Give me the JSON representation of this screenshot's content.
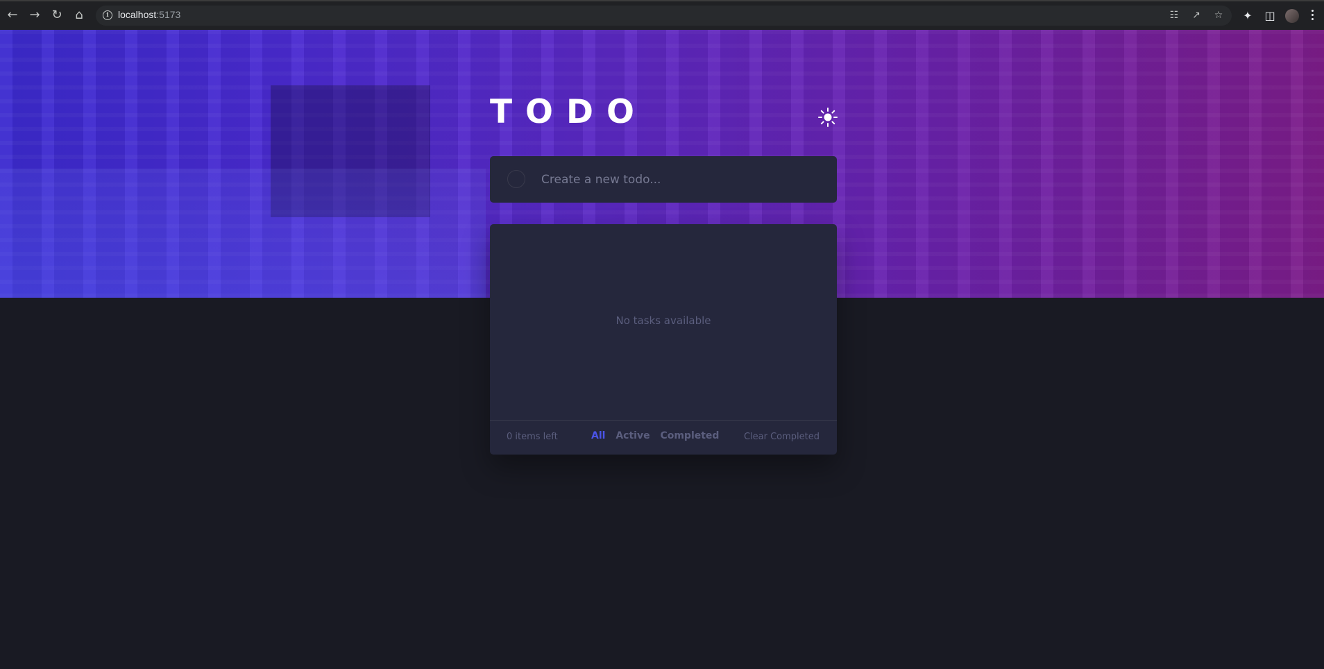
{
  "browser": {
    "url_host": "localhost",
    "url_port": ":5173",
    "icons": [
      "back-icon",
      "forward-icon",
      "reload-icon",
      "home-icon",
      "info-icon",
      "translate-icon",
      "share-icon",
      "star-icon",
      "extensions-icon",
      "sidepanel-icon",
      "profile-avatar",
      "menu-icon"
    ]
  },
  "app": {
    "title": "TODO",
    "theme_icon": "sun-icon",
    "new_todo_placeholder": "Create a new todo...",
    "empty_message": "No tasks available",
    "items_left": "0 items left",
    "filters": [
      {
        "label": "All",
        "active": true
      },
      {
        "label": "Active",
        "active": false
      },
      {
        "label": "Completed",
        "active": false
      }
    ],
    "clear_completed": "Clear Completed"
  },
  "colors": {
    "accent": "#4b54e8",
    "background": "#191a23",
    "card": "#25273c",
    "muted_text": "#5b5e7e"
  }
}
